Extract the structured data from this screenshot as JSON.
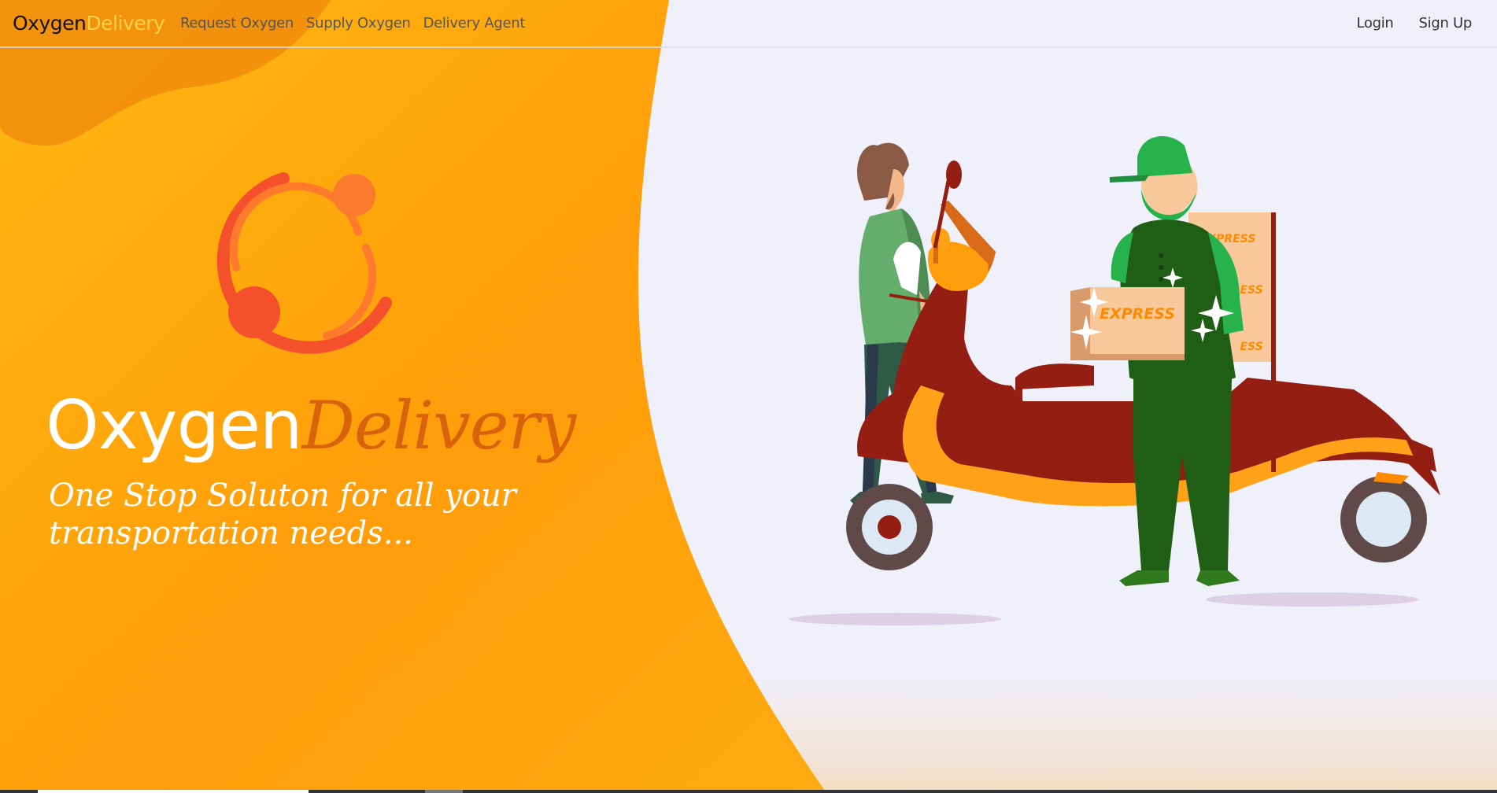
{
  "navbar": {
    "brand_part1": "Oxygen",
    "brand_part2": "Delivery",
    "links": [
      "Request Oxygen",
      "Supply Oxygen",
      "Delivery Agent"
    ],
    "login": "Login",
    "signup": "Sign Up"
  },
  "hero": {
    "title_part1": "Oxygen",
    "title_part2": "Delivery",
    "tagline": "One Stop Soluton for all your transportation needs..."
  },
  "illustration": {
    "box_label": "EXPRESS",
    "stack_label_1": "EXPRESS",
    "stack_label_2": "ESS",
    "stack_label_3": "ESS"
  },
  "colors": {
    "orange_light": "#ffb514",
    "orange_dark": "#ff8a00",
    "accent": "#ffd24a",
    "page_bg": "#f0f0fb"
  }
}
